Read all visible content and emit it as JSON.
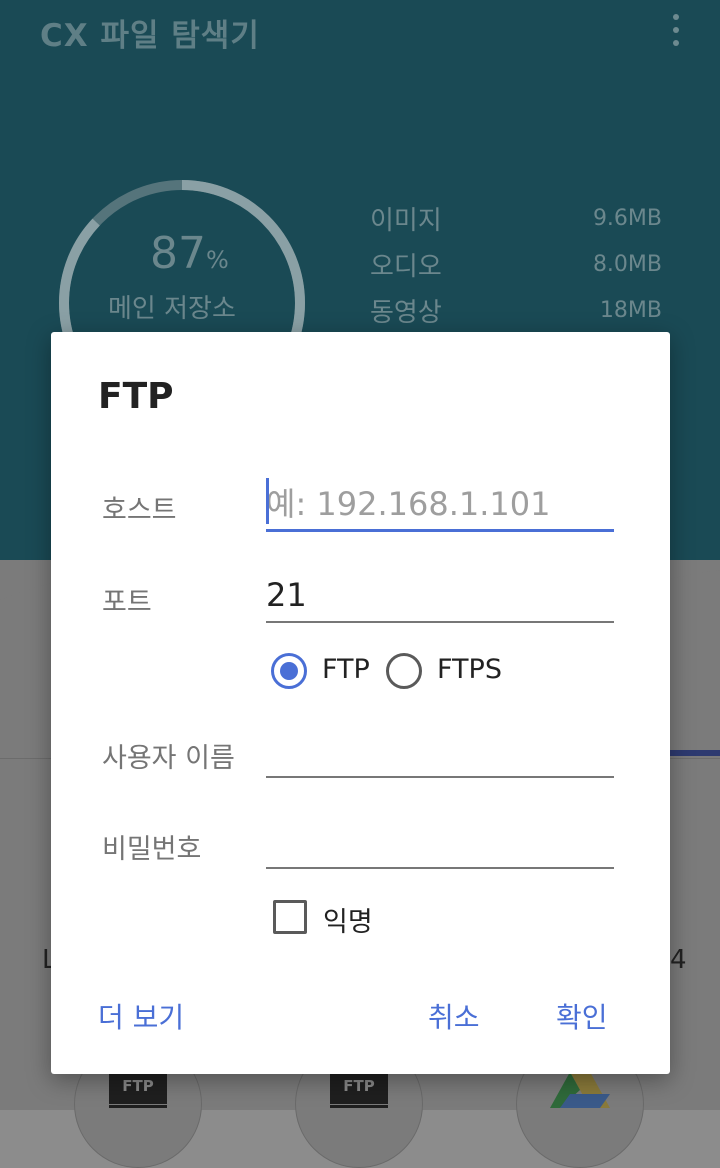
{
  "app": {
    "title": "CX 파일 탐색기",
    "storage": {
      "percent": "87",
      "percent_sign": "%",
      "label": "메인 저장소",
      "used_fraction": 0.87
    },
    "stats": [
      {
        "label": "이미지",
        "value": "9.6MB"
      },
      {
        "label": "오디오",
        "value": "8.0MB"
      },
      {
        "label": "동영상",
        "value": "18MB"
      }
    ],
    "peek_left": "L",
    "peek_right": "4",
    "tiles": [
      "FTP",
      "FTP"
    ]
  },
  "dialog": {
    "title": "FTP",
    "host": {
      "label": "호스트",
      "value": "",
      "placeholder": "예: 192.168.1.101"
    },
    "port": {
      "label": "포트",
      "value": "21"
    },
    "protocol": {
      "options": [
        "FTP",
        "FTPS"
      ],
      "selected": "FTP"
    },
    "username": {
      "label": "사용자 이름",
      "value": ""
    },
    "password": {
      "label": "비밀번호",
      "value": ""
    },
    "anonymous": {
      "label": "익명",
      "checked": false
    },
    "buttons": {
      "more": "더 보기",
      "cancel": "취소",
      "ok": "확인"
    }
  },
  "colors": {
    "accent": "#4a6fd6",
    "header": "#1a4a55"
  }
}
